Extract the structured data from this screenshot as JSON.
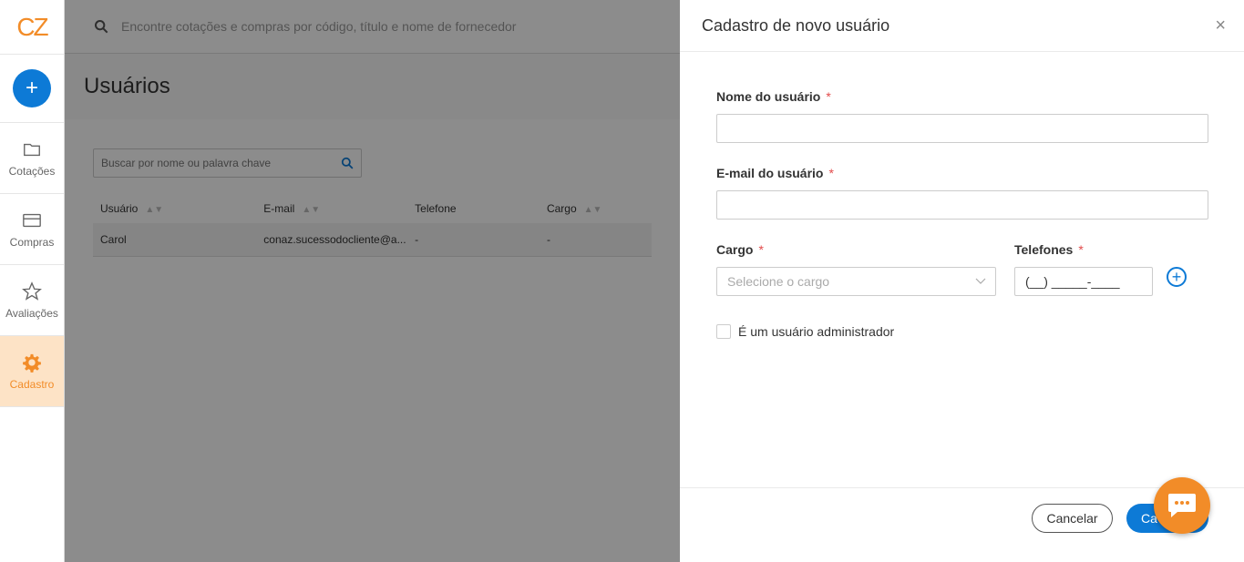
{
  "sidebar": {
    "logo": "CZ",
    "add_label": "+",
    "items": [
      {
        "label": "Cotações",
        "icon": "folder-icon"
      },
      {
        "label": "Compras",
        "icon": "card-icon"
      },
      {
        "label": "Avaliações",
        "icon": "star-icon"
      },
      {
        "label": "Cadastro",
        "icon": "gear-icon",
        "active": true
      }
    ]
  },
  "topbar": {
    "search_placeholder": "Encontre cotações e compras por código, título e nome de fornecedor"
  },
  "page": {
    "title": "Usuários",
    "search_placeholder": "Buscar por nome ou palavra chave",
    "table": {
      "headers": [
        "Usuário",
        "E-mail",
        "Telefone",
        "Cargo"
      ],
      "rows": [
        [
          "Carol",
          "conaz.sucessodocliente@a...",
          "-",
          "-"
        ]
      ]
    }
  },
  "drawer": {
    "title": "Cadastro de novo usuário",
    "close": "×",
    "fields": {
      "name_label": "Nome do usuário",
      "email_label": "E-mail do usuário",
      "cargo_label": "Cargo",
      "cargo_placeholder": "Selecione o cargo",
      "phones_label": "Telefones",
      "phone_mask": "(__) _____-____",
      "admin_label": "É um usuário administrador",
      "required_mark": "*"
    },
    "footer": {
      "cancel": "Cancelar",
      "submit": "Ca"
    }
  },
  "colors": {
    "brand_orange": "#f28c28",
    "primary_blue": "#0d7ad6"
  }
}
